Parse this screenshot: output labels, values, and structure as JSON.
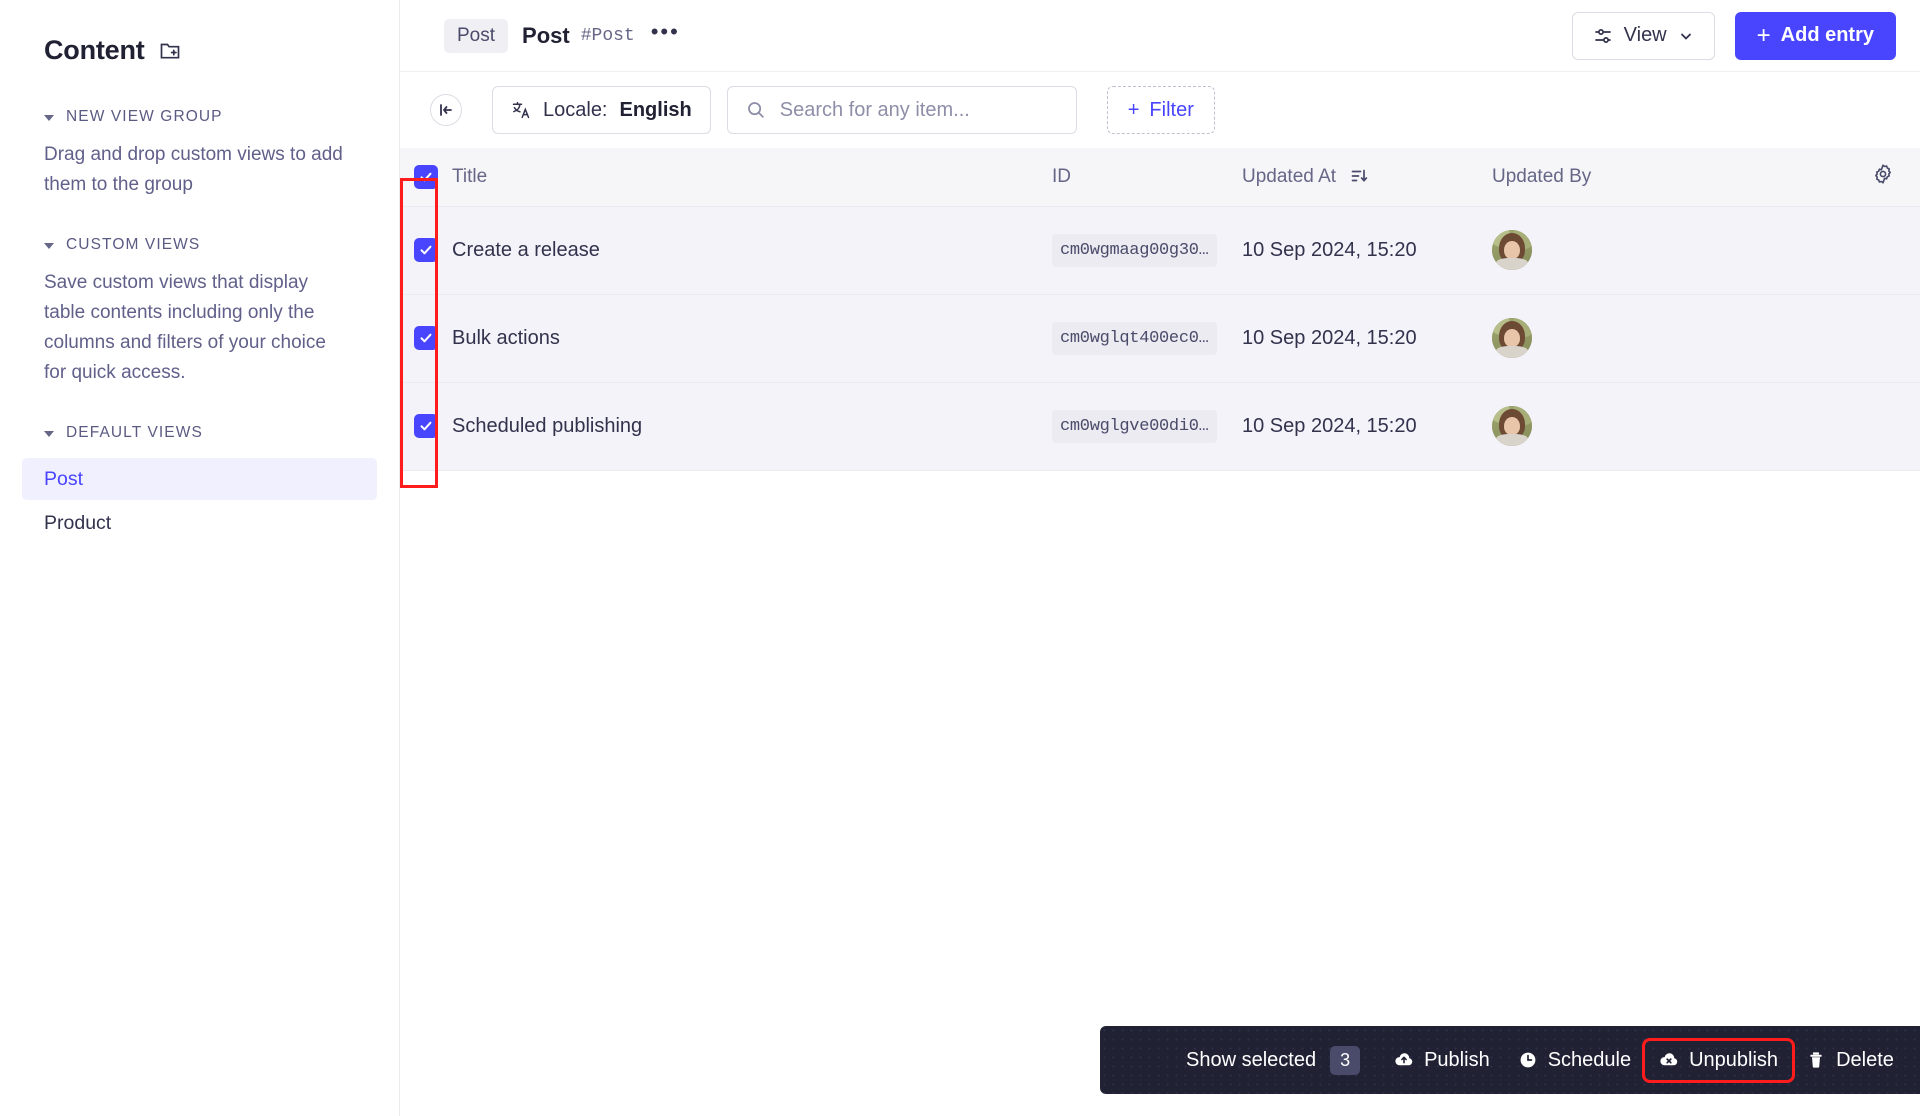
{
  "sidebar": {
    "title": "Content",
    "add_folder_icon": "folder-add-icon",
    "sections": [
      {
        "label": "NEW VIEW GROUP",
        "description": "Drag and drop custom views to add them to the group"
      },
      {
        "label": "CUSTOM VIEWS",
        "description": "Save custom views that display table contents including only the columns and filters of your choice for quick access."
      },
      {
        "label": "DEFAULT VIEWS",
        "description": ""
      }
    ],
    "default_views": [
      {
        "label": "Post",
        "active": true
      },
      {
        "label": "Product",
        "active": false
      }
    ]
  },
  "header": {
    "breadcrumb_chip": "Post",
    "title": "Post",
    "uid": "#Post",
    "more_label": "•••",
    "view_button": "View",
    "view_icon": "sliders-icon",
    "chevron_icon": "chevron-down-icon",
    "add_entry_button": "Add entry",
    "add_icon": "plus-icon"
  },
  "toolbar": {
    "collapse_icon": "collapse-left-icon",
    "locale_icon": "translate-icon",
    "locale_label": "Locale:",
    "locale_value": "English",
    "search_icon": "search-icon",
    "search_placeholder": "Search for any item...",
    "search_value": "",
    "filter_button": "Filter",
    "filter_icon": "plus-icon"
  },
  "table": {
    "select_all_checked": true,
    "columns": [
      {
        "key": "title",
        "label": "Title"
      },
      {
        "key": "id",
        "label": "ID"
      },
      {
        "key": "updated_at",
        "label": "Updated At",
        "sort_icon": "sort-descending-icon"
      },
      {
        "key": "updated_by",
        "label": "Updated By"
      }
    ],
    "settings_icon": "gear-icon",
    "rows": [
      {
        "checked": true,
        "title": "Create a release",
        "id": "cm0wgmaag00g30…",
        "updated_at": "10 Sep 2024, 15:20",
        "updated_by": "avatar"
      },
      {
        "checked": true,
        "title": "Bulk actions",
        "id": "cm0wglqt400ec0…",
        "updated_at": "10 Sep 2024, 15:20",
        "updated_by": "avatar"
      },
      {
        "checked": true,
        "title": "Scheduled publishing",
        "id": "cm0wglgve00di0…",
        "updated_at": "10 Sep 2024, 15:20",
        "updated_by": "avatar"
      }
    ]
  },
  "bulk_bar": {
    "show_selected_label": "Show selected",
    "selected_count": "3",
    "actions": [
      {
        "label": "Publish",
        "icon": "cloud-upload-icon",
        "highlighted": false
      },
      {
        "label": "Schedule",
        "icon": "clock-icon",
        "highlighted": false
      },
      {
        "label": "Unpublish",
        "icon": "cloud-cross-icon",
        "highlighted": true
      },
      {
        "label": "Delete",
        "icon": "trash-icon",
        "highlighted": false
      }
    ],
    "close_icon": "close-icon"
  },
  "colors": {
    "accent": "#4945ff",
    "accent_soft": "#f0f0ff",
    "text": "#32324d",
    "muted": "#666687",
    "row_bg": "#f3f3f9",
    "header_bg": "#f6f6f9",
    "dark_bar": "#212134",
    "annotation": "#ff1c1c"
  }
}
